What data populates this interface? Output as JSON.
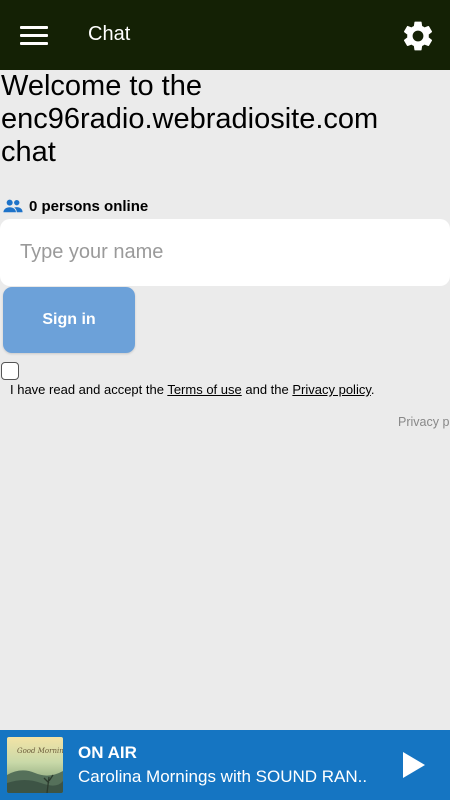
{
  "appbar": {
    "title": "Chat",
    "menu_icon": "hamburger-menu-icon",
    "settings_icon": "gear-icon",
    "background": "#142105"
  },
  "main": {
    "welcome_heading": "Welcome to the enc96radio.webradiosite.com chat",
    "online_icon": "people-icon",
    "online_text": "0 persons online",
    "name_placeholder": "Type your name",
    "name_value": "",
    "signin_label": "Sign in",
    "signin_color": "#6ca1d9",
    "accept_checked": false,
    "accept_prefix": "I have read and accept the ",
    "terms_link": "Terms of use",
    "accept_middle": " and the ",
    "privacy_link": "Privacy policy",
    "accept_suffix": ".",
    "privacy_footer": "Privacy p"
  },
  "player": {
    "status": "ON AIR",
    "track": "Carolina Mornings with SOUND RAN..",
    "play_icon": "play-icon",
    "album_art_text": "Good Morning",
    "background": "#1575c2"
  }
}
